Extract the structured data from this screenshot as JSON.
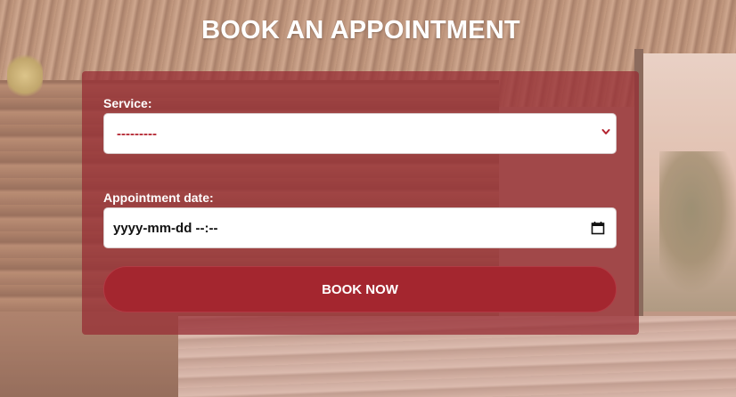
{
  "page": {
    "title": "BOOK AN APPOINTMENT"
  },
  "form": {
    "service_label": "Service:",
    "service_value": "---------",
    "date_label": "Appointment date:",
    "date_value": "yyyy-mm-dd --:--",
    "submit_label": "BOOK NOW"
  },
  "icons": {
    "select_arrow": "chevron-down-icon",
    "date_picker": "calendar-icon"
  },
  "colors": {
    "accent": "#a4262f",
    "card": "#962a32",
    "select_text": "#b3232f"
  }
}
